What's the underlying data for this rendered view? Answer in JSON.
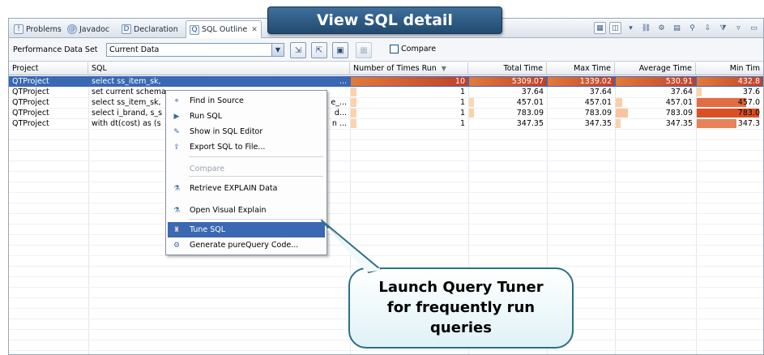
{
  "banner": {
    "title": "View SQL detail"
  },
  "callout": {
    "line1": "Launch Query Tuner",
    "line2": "for frequently run",
    "line3": "queries"
  },
  "tabs": [
    {
      "label": "Problems",
      "icon": "problems-icon"
    },
    {
      "label": "Javadoc",
      "icon": "javadoc-icon"
    },
    {
      "label": "Declaration",
      "icon": "declaration-icon"
    },
    {
      "label": "SQL Outline",
      "icon": "sql-outline-icon",
      "active": true
    }
  ],
  "toolbar": {
    "performance_label": "Performance Data Set",
    "performance_value": "Current Data",
    "compare_label": "Compare"
  },
  "table": {
    "columns": {
      "project": "Project",
      "sql": "SQL",
      "runs": "Number of Times Run",
      "total": "Total Time",
      "max": "Max Time",
      "avg": "Average Time",
      "min": "Min Tim"
    },
    "rows": [
      {
        "project": "QTProject",
        "sql": "select ss_item_sk,",
        "sql_tail": "...",
        "runs": "10",
        "total": "5309.07",
        "max": "1339.02",
        "avg": "530.91",
        "min": "432.8",
        "selected": true,
        "heat": [
          0.9,
          1.0,
          0.55,
          1.0,
          1.0
        ]
      },
      {
        "project": "QTProject",
        "sql": "set current schema",
        "sql_tail": "",
        "runs": "1",
        "total": "37.64",
        "max": "37.64",
        "avg": "37.64",
        "min": "37.6",
        "selected": false,
        "heat": [
          0.05,
          0.0,
          0.0,
          0.0,
          0.05
        ]
      },
      {
        "project": "QTProject",
        "sql": "select ss_item_sk,",
        "sql_tail": "e_...",
        "runs": "1",
        "total": "457.01",
        "max": "457.01",
        "avg": "457.01",
        "min": "457.0",
        "selected": false,
        "heat": [
          0.05,
          0.02,
          0.0,
          0.08,
          0.75
        ]
      },
      {
        "project": "QTProject",
        "sql": "select i_brand, s_s",
        "sql_tail": "d...",
        "runs": "1",
        "total": "783.09",
        "max": "783.09",
        "avg": "783.09",
        "min": "783.0",
        "selected": false,
        "heat": [
          0.05,
          0.06,
          0.0,
          0.15,
          0.95
        ]
      },
      {
        "project": "QTProject",
        "sql": "with dt(cost) as (s",
        "sql_tail": "n ...",
        "runs": "1",
        "total": "347.35",
        "max": "347.35",
        "avg": "347.35",
        "min": "347.3",
        "selected": false,
        "heat": [
          0.05,
          0.0,
          0.0,
          0.06,
          0.6
        ]
      }
    ]
  },
  "context_menu": {
    "items": [
      {
        "label": "Find in Source",
        "icon": "find-source-icon"
      },
      {
        "label": "Run SQL",
        "icon": "run-sql-icon"
      },
      {
        "label": "Show in SQL Editor",
        "icon": "sql-editor-icon"
      },
      {
        "label": "Export SQL to File...",
        "icon": "export-file-icon"
      },
      {
        "label": "Compare",
        "icon": "",
        "disabled": true
      },
      {
        "label": "Retrieve EXPLAIN Data",
        "icon": "explain-data-icon"
      },
      {
        "label": "Open Visual Explain",
        "icon": "visual-explain-icon"
      },
      {
        "label": "Tune SQL",
        "icon": "tune-sql-icon",
        "highlighted": true
      },
      {
        "label": "Generate pureQuery Code...",
        "icon": "purequery-icon"
      }
    ]
  },
  "colors": {
    "selection": "#3a68b2",
    "heat_low": "#ffd9b3",
    "heat_high": "#d9481f",
    "banner": "#2b5a82",
    "callout_border": "#2f6f87"
  }
}
